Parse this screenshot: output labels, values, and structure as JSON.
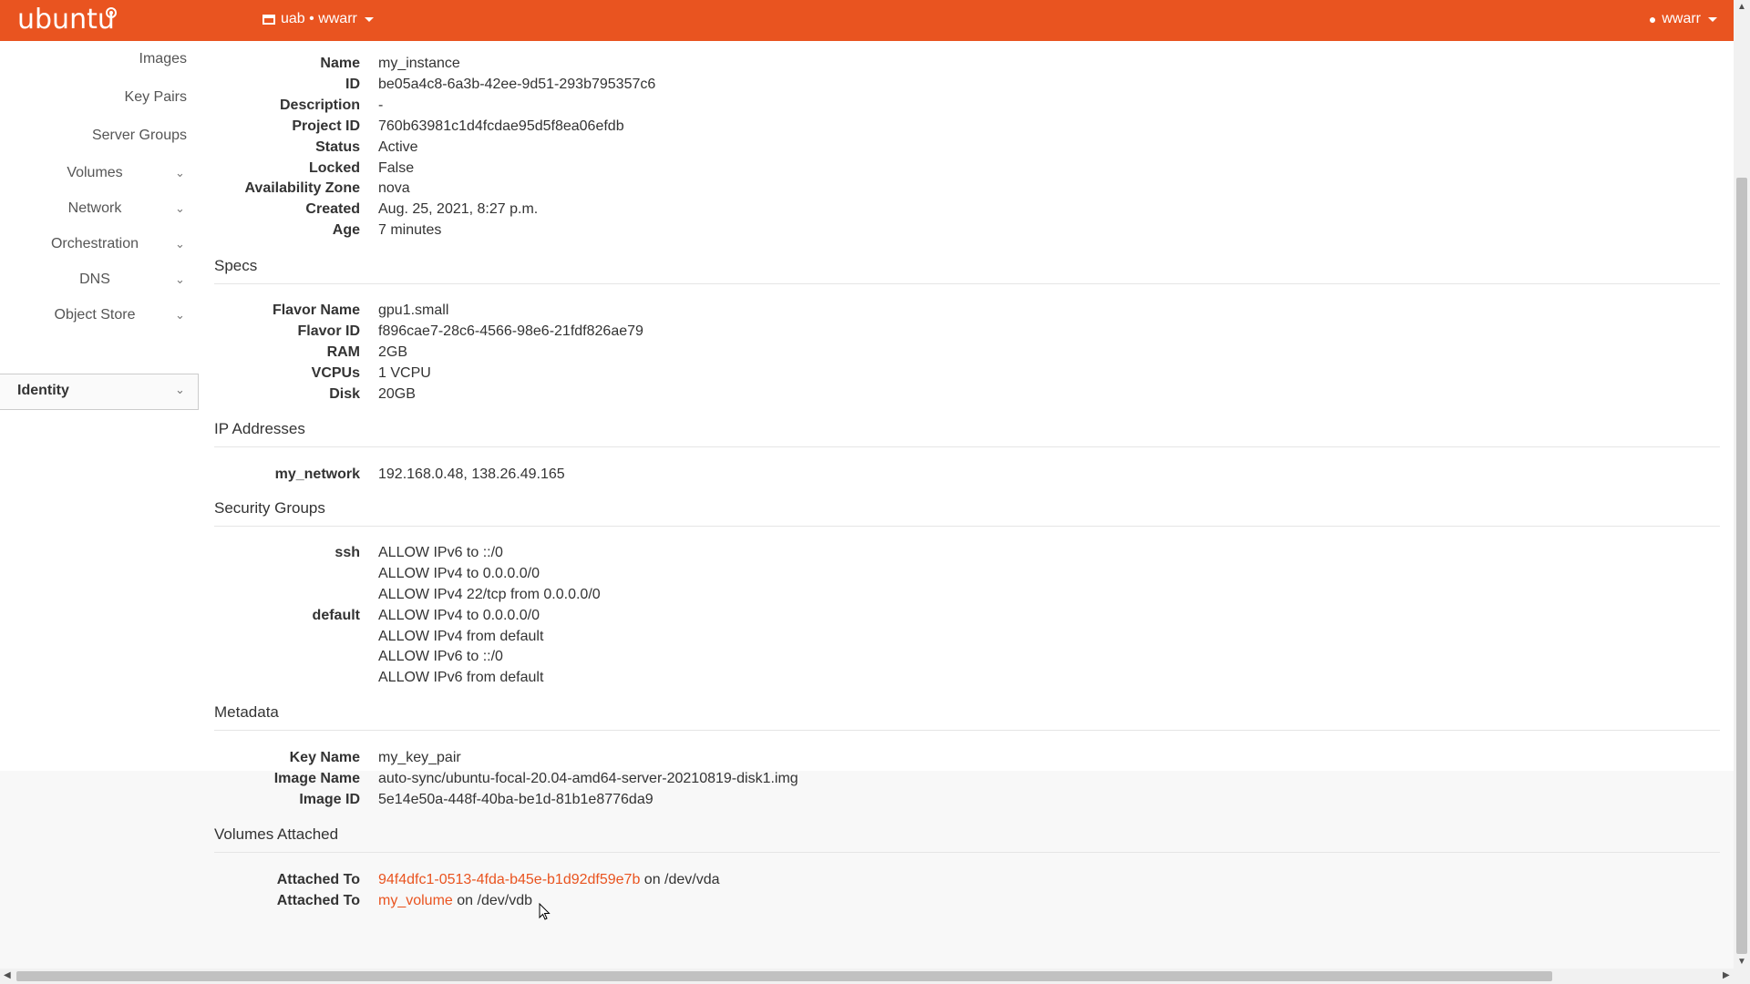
{
  "topbar": {
    "brand": "ubuntu",
    "project_label": "uab • wwarr",
    "user_label": "wwarr"
  },
  "sidebar": {
    "items": [
      {
        "label": "Images",
        "has_chevron": false
      },
      {
        "label": "Key Pairs",
        "has_chevron": false
      },
      {
        "label": "Server Groups",
        "has_chevron": false
      },
      {
        "label": "Volumes",
        "has_chevron": true
      },
      {
        "label": "Network",
        "has_chevron": true
      },
      {
        "label": "Orchestration",
        "has_chevron": true
      },
      {
        "label": "DNS",
        "has_chevron": true
      },
      {
        "label": "Object Store",
        "has_chevron": true
      },
      {
        "label": "Identity",
        "has_chevron": true
      }
    ],
    "chevron": "⌄"
  },
  "overview": {
    "name_k": "Name",
    "name_v": "my_instance",
    "id_k": "ID",
    "id_v": "be05a4c8-6a3b-42ee-9d51-293b795357c6",
    "desc_k": "Description",
    "desc_v": "-",
    "project_k": "Project ID",
    "project_v": "760b63981c1d4fcdae95d5f8ea06efdb",
    "status_k": "Status",
    "status_v": "Active",
    "locked_k": "Locked",
    "locked_v": "False",
    "az_k": "Availability Zone",
    "az_v": "nova",
    "created_k": "Created",
    "created_v": "Aug. 25, 2021, 8:27 p.m.",
    "age_k": "Age",
    "age_v": "7 minutes"
  },
  "specs": {
    "title": "Specs",
    "flavor_name_k": "Flavor Name",
    "flavor_name_v": "gpu1.small",
    "flavor_id_k": "Flavor ID",
    "flavor_id_v": "f896cae7-28c6-4566-98e6-21fdf826ae79",
    "ram_k": "RAM",
    "ram_v": "2GB",
    "vcpus_k": "VCPUs",
    "vcpus_v": "1 VCPU",
    "disk_k": "Disk",
    "disk_v": "20GB"
  },
  "ip": {
    "title": "IP Addresses",
    "net_k": "my_network",
    "net_v": "192.168.0.48,  138.26.49.165"
  },
  "security": {
    "title": "Security Groups",
    "ssh_k": "ssh",
    "ssh_rules": [
      "ALLOW IPv6 to ::/0",
      "ALLOW IPv4 to 0.0.0.0/0",
      "ALLOW IPv4 22/tcp from 0.0.0.0/0"
    ],
    "default_k": "default",
    "default_rules": [
      "ALLOW IPv4 to 0.0.0.0/0",
      "ALLOW IPv4 from default",
      "ALLOW IPv6 to ::/0",
      "ALLOW IPv6 from default"
    ]
  },
  "metadata": {
    "title": "Metadata",
    "key_name_k": "Key Name",
    "key_name_v": "my_key_pair",
    "image_name_k": "Image Name",
    "image_name_v": "auto-sync/ubuntu-focal-20.04-amd64-server-20210819-disk1.img",
    "image_id_k": "Image ID",
    "image_id_v": "5e14e50a-448f-40ba-be1d-81b1e8776da9"
  },
  "volumes": {
    "title": "Volumes Attached",
    "att1_k": "Attached To",
    "att1_link": "94f4dfc1-0513-4fda-b45e-b1d92df59e7b",
    "att1_suffix": " on /dev/vda",
    "att2_k": "Attached To",
    "att2_link": "my_volume",
    "att2_suffix": " on /dev/vdb"
  },
  "colors": {
    "brand": "#e95420",
    "link": "#e95420"
  }
}
